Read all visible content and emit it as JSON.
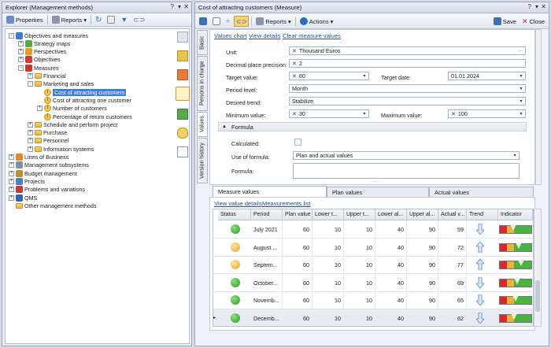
{
  "explorer": {
    "title": "Explorer (Management methods)",
    "title_controls": [
      "?",
      "▾",
      "✕"
    ],
    "toolbar": {
      "properties": "Properties",
      "reports": "Reports"
    },
    "tree": [
      {
        "label": "Objectives and measures",
        "depth": 0,
        "exp": "-",
        "icon": "objectives-icon"
      },
      {
        "label": "Strategy maps",
        "depth": 1,
        "exp": "+",
        "icon": "strategy-map-icon"
      },
      {
        "label": "Perspectives",
        "depth": 1,
        "exp": "+",
        "icon": "perspectives-icon"
      },
      {
        "label": "Objectives",
        "depth": 1,
        "exp": "+",
        "icon": "target-icon"
      },
      {
        "label": "Measures",
        "depth": 1,
        "exp": "-",
        "icon": "measures-icon"
      },
      {
        "label": "Financial",
        "depth": 2,
        "exp": "+",
        "icon": "folder-icon"
      },
      {
        "label": "Marketing and sales",
        "depth": 2,
        "exp": "-",
        "icon": "folder-icon"
      },
      {
        "label": "Cost of attracting customers",
        "depth": 3,
        "exp": "",
        "icon": "measure-icon",
        "selected": true
      },
      {
        "label": "Cost of attracting one customer",
        "depth": 3,
        "exp": "",
        "icon": "measure-icon"
      },
      {
        "label": "Number of customers",
        "depth": 3,
        "exp": "+",
        "icon": "measure-icon"
      },
      {
        "label": "Percentage of return customers",
        "depth": 3,
        "exp": "",
        "icon": "measure-icon"
      },
      {
        "label": "Schedule and perform project",
        "depth": 2,
        "exp": "+",
        "icon": "folder-icon"
      },
      {
        "label": "Purchase",
        "depth": 2,
        "exp": "+",
        "icon": "folder-icon"
      },
      {
        "label": "Personnel",
        "depth": 2,
        "exp": "+",
        "icon": "folder-icon"
      },
      {
        "label": "Information systems",
        "depth": 2,
        "exp": "+",
        "icon": "folder-icon"
      },
      {
        "label": "Lines of Business",
        "depth": 0,
        "exp": "+",
        "icon": "business-icon"
      },
      {
        "label": "Management subsystems",
        "depth": 0,
        "exp": "+",
        "icon": "subsystems-icon"
      },
      {
        "label": "Budget management",
        "depth": 0,
        "exp": "+",
        "icon": "budget-icon"
      },
      {
        "label": "Projects",
        "depth": 0,
        "exp": "+",
        "icon": "projects-icon"
      },
      {
        "label": "Problems and variations",
        "depth": 0,
        "exp": "+",
        "icon": "problems-icon"
      },
      {
        "label": "QMS",
        "depth": 0,
        "exp": "+",
        "icon": "qms-icon"
      },
      {
        "label": "Other management methods",
        "depth": 0,
        "exp": "",
        "icon": "folder-icon"
      }
    ]
  },
  "measure": {
    "title": "Cost of attracting customers (Measure)",
    "title_controls": [
      "?",
      "▾",
      "✕"
    ],
    "toolbar": {
      "reports": "Reports",
      "actions": "Actions",
      "save": "Save",
      "close": "Close"
    },
    "side_tabs": [
      "Basic",
      "Persons in charge",
      "Values",
      "Version history"
    ],
    "links": [
      "Values chart",
      "View details",
      "Clear measure values"
    ],
    "fields": {
      "unit_label": "Unit:",
      "unit": "Thousand Euros",
      "precision_label": "Decimal place precision:",
      "precision": "2",
      "target_label": "Target value:",
      "target": "60",
      "target_date_label": "Target date:",
      "target_date": "01.01.2024",
      "period_label": "Period level:",
      "period": "Month",
      "trend_label": "Desired trend:",
      "trend": "Stabilize",
      "min_label": "Minimum value:",
      "min": "30",
      "max_label": "Maximum value:",
      "max": "100"
    },
    "formula": {
      "header": "Formula",
      "calculated_label": "Calculated:",
      "use_label": "Use of formula:",
      "use": "Plan and actual values",
      "formula_label": "Formula:"
    },
    "tabs": [
      "Measure values",
      "Plan values",
      "Actual values"
    ],
    "grid_links": [
      "View value details",
      "Measurements list"
    ],
    "columns": [
      "Status",
      "Period",
      "Plan value",
      "Lower t...",
      "Upper t...",
      "Lower al...",
      "Upper al...",
      "Actual v...",
      "Trend",
      "Indicator"
    ],
    "rows": [
      {
        "status": "green",
        "period": "July 2021",
        "plan": "60",
        "lt": "10",
        "ut": "10",
        "la": "40",
        "ua": "90",
        "actual": "59",
        "trend": "down"
      },
      {
        "status": "yellow",
        "period": "August ...",
        "plan": "60",
        "lt": "10",
        "ut": "10",
        "la": "40",
        "ua": "90",
        "actual": "72",
        "trend": "up"
      },
      {
        "status": "yellow",
        "period": "Septem...",
        "plan": "60",
        "lt": "10",
        "ut": "10",
        "la": "40",
        "ua": "90",
        "actual": "77",
        "trend": "up"
      },
      {
        "status": "green",
        "period": "October...",
        "plan": "60",
        "lt": "10",
        "ut": "10",
        "la": "40",
        "ua": "90",
        "actual": "69",
        "trend": "down"
      },
      {
        "status": "green",
        "period": "Novemb...",
        "plan": "60",
        "lt": "10",
        "ut": "10",
        "la": "40",
        "ua": "90",
        "actual": "65",
        "trend": "down"
      },
      {
        "status": "green",
        "period": "Decemb...",
        "plan": "60",
        "lt": "10",
        "ut": "10",
        "la": "40",
        "ua": "90",
        "actual": "62",
        "trend": "down"
      }
    ]
  }
}
